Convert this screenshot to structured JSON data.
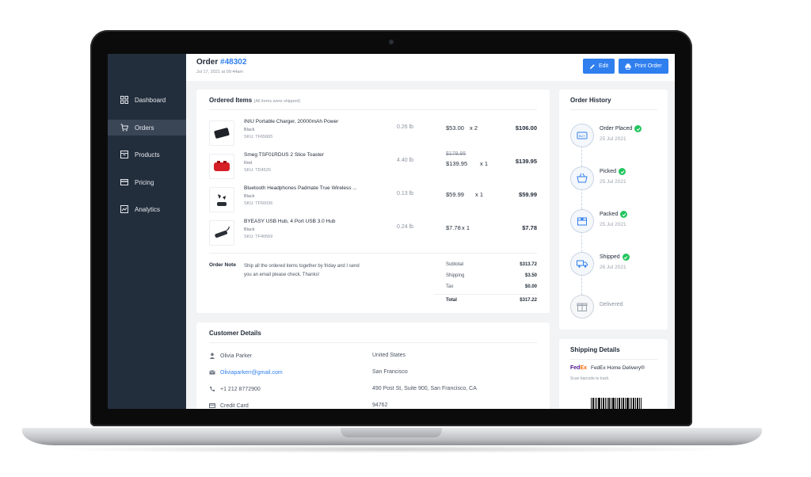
{
  "sidebar": {
    "items": [
      {
        "label": "Dashboard",
        "icon": "dashboard-icon"
      },
      {
        "label": "Orders",
        "icon": "cart-icon",
        "active": true
      },
      {
        "label": "Products",
        "icon": "box-icon"
      },
      {
        "label": "Pricing",
        "icon": "card-icon"
      },
      {
        "label": "Analytics",
        "icon": "chart-icon"
      }
    ]
  },
  "header": {
    "title_prefix": "Order",
    "order_number": "#48302",
    "date": "Jul 17, 2021 at 09:44am",
    "edit_label": "Edit",
    "print_label": "Print Order"
  },
  "ordered_items": {
    "title": "Ordered Items",
    "subtitle": "(All items were shipped)",
    "items": [
      {
        "name": "INIU Portable Charger, 20000mAh Power",
        "color": "Black",
        "sku": "SKU: TF65665",
        "weight": "0.26 lb",
        "original_price": "",
        "price": "$53.00",
        "qty": "x  2",
        "total": "$106.00"
      },
      {
        "name": "Smeg TSF01RDUS 2 Slice Toaster",
        "color": "Red",
        "sku": "SKU: TD4520",
        "weight": "4.40 lb",
        "original_price": "$179.95",
        "price": "$139.95",
        "qty": "x  1",
        "total": "$139.95"
      },
      {
        "name": "Bluetooth Headphones Padmate True Wireless ...",
        "color": "Black",
        "sku": "SKU: TF50036",
        "weight": "0.13 lb",
        "original_price": "",
        "price": "$59.99",
        "qty": "x  1",
        "total": "$59.99"
      },
      {
        "name": "BYEASY USB Hub, 4 Port USB 3.0 Hub",
        "color": "Black",
        "sku": "SKU: TF40569",
        "weight": "0.24 lb",
        "original_price": "",
        "price": "$7.78",
        "qty": "x  1",
        "total": "$7.78"
      }
    ],
    "note_label": "Order Note",
    "note_text": "Ship all the ordered items together by friday and I send you an email please check. Thanks!",
    "summary": {
      "subtotal_label": "Subtotal",
      "subtotal": "$313.72",
      "shipping_label": "Shipping",
      "shipping": "$3.50",
      "tax_label": "Tax",
      "tax": "$0.00",
      "total_label": "Total",
      "total": "$317.22"
    }
  },
  "customer": {
    "title": "Customer Details",
    "name": "Olivia Parker",
    "email": "Oliviaparkerr@gmail.com",
    "phone": "+1 212 8772900",
    "payment": "Credit Card",
    "country": "United States",
    "city": "San Francisco",
    "address": "490 Post St, Suite 900, San Francisco, CA",
    "zip": "94762"
  },
  "history": {
    "title": "Order History",
    "steps": [
      {
        "label": "Order Placed",
        "date": "25 Jul 2021",
        "done": true
      },
      {
        "label": "Picked",
        "date": "25 Jul 2021",
        "done": true
      },
      {
        "label": "Packed",
        "date": "25 Jul 2021",
        "done": true
      },
      {
        "label": "Shipped",
        "date": "26 Jul 2021",
        "done": true
      },
      {
        "label": "Delivered",
        "date": "",
        "done": false
      }
    ]
  },
  "shipping": {
    "title": "Shipping Details",
    "carrier_logo": "FedEx",
    "carrier_logo_fed": "Fed",
    "carrier_logo_ex": "Ex",
    "service": "FedEx Home Delivery®",
    "hint": "Scan barcode to track"
  },
  "colors": {
    "accent": "#2f7fef",
    "sidebar": "#232e3c",
    "success": "#22c55e",
    "fedex_purple": "#4d148c",
    "fedex_orange": "#ff6600"
  }
}
